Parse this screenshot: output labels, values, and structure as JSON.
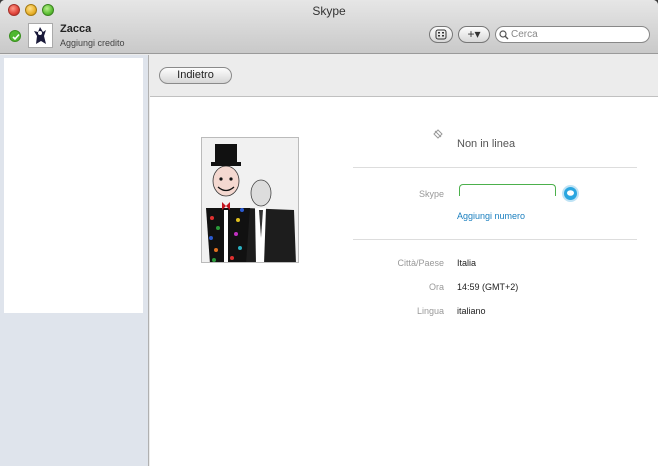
{
  "window": {
    "title": "Skype"
  },
  "user": {
    "name": "Zacca",
    "credit_link": "Aggiungi credito",
    "status_icon": "online-check-icon"
  },
  "toolbar": {
    "dial_icon": "dialpad-icon",
    "add_label": "+▾",
    "search_placeholder": "Cerca"
  },
  "main": {
    "back_label": "Indietro",
    "status": "Non in linea",
    "skype_label": "Skype",
    "add_number": "Aggiungi numero",
    "details": [
      {
        "label": "Città/Paese",
        "value": "Italia"
      },
      {
        "label": "Ora",
        "value": "14:59 (GMT+2)"
      },
      {
        "label": "Lingua",
        "value": "italiano"
      }
    ]
  },
  "colors": {
    "online": "#4fb82f",
    "link": "#1a7fbf",
    "call": "#2aa6e0"
  }
}
